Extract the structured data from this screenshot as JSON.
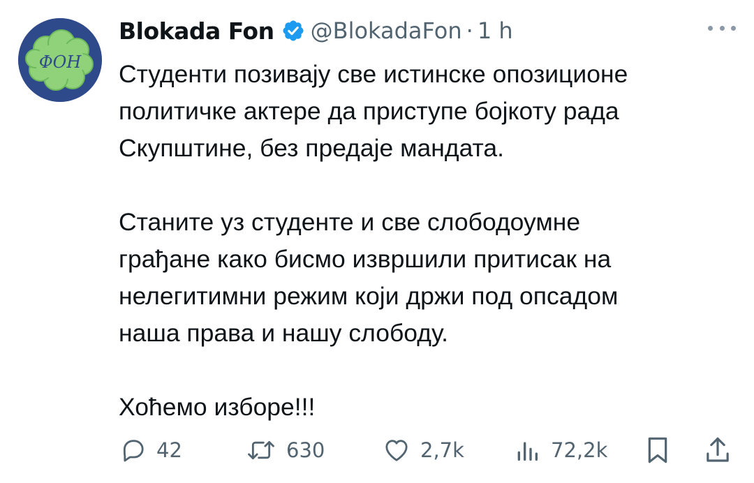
{
  "author": {
    "display_name": "Blokada Fon",
    "handle": "@BlokadaFon",
    "separator": "·",
    "time": "1 h",
    "avatar_text": "ФОН",
    "verified_icon": "verified-badge-icon",
    "avatar_colors": {
      "ring": "#2f4a8a",
      "cloud": "#8fd27a",
      "cloud_edge": "#6cb85a",
      "text": "#2f4a8a"
    }
  },
  "tweet": {
    "paragraphs": [
      [
        "Студенти позивају све истинске опозиционе",
        "политичке актере да приступе бојкоту рада",
        "Скупштине, без предаје мандата."
      ],
      [
        "Станите уз студенте и све слободоумне",
        "грађане како бисмо извршили притисак на",
        "нелегитимни режим који држи под опсадом",
        "наша права и нашу слободу."
      ],
      [
        "Хоћемо изборе!!!"
      ]
    ]
  },
  "actions": {
    "reply": {
      "icon": "reply-icon",
      "count": "42"
    },
    "retweet": {
      "icon": "retweet-icon",
      "count": "630"
    },
    "like": {
      "icon": "heart-icon",
      "count": "2,7k"
    },
    "views": {
      "icon": "views-icon",
      "count": "72,2k"
    },
    "bookmark": {
      "icon": "bookmark-icon"
    },
    "share": {
      "icon": "share-icon"
    }
  },
  "colors": {
    "text": "#0f1419",
    "secondary": "#536471",
    "verified": "#1d9bf0"
  }
}
